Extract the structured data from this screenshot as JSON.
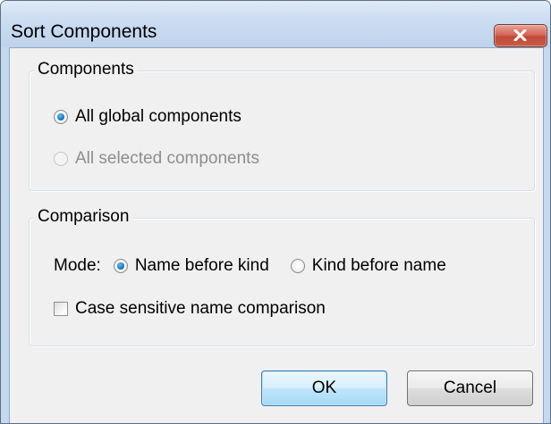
{
  "window": {
    "title": "Sort Components"
  },
  "components_group": {
    "legend": "Components",
    "options": [
      {
        "label": "All global components",
        "checked": true,
        "enabled": true
      },
      {
        "label": "All selected components",
        "checked": false,
        "enabled": false
      }
    ]
  },
  "comparison_group": {
    "legend": "Comparison",
    "mode_label": "Mode:",
    "mode_options": [
      {
        "label": "Name before kind",
        "checked": true
      },
      {
        "label": "Kind before name",
        "checked": false
      }
    ],
    "case_sensitive": {
      "label": "Case sensitive name comparison",
      "checked": false
    }
  },
  "buttons": {
    "ok": "OK",
    "cancel": "Cancel"
  },
  "icons": {
    "close": "close-icon"
  }
}
